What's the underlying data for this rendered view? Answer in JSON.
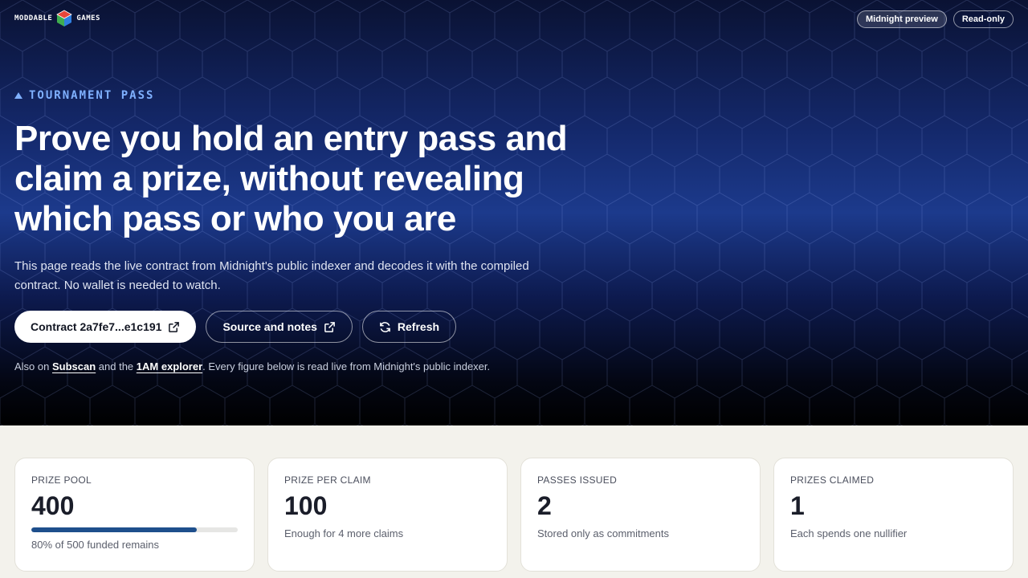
{
  "brand": {
    "left": "MODDABLE",
    "right": "GAMES"
  },
  "header_pills": [
    {
      "label": "Midnight preview",
      "active": true
    },
    {
      "label": "Read-only",
      "active": false
    }
  ],
  "hero": {
    "eyebrow": "TOURNAMENT PASS",
    "headline_lines": [
      "Prove you hold an entry pass and",
      "claim a prize, without revealing",
      "which pass or who you are"
    ],
    "intro": "This page reads the live contract from Midnight's public indexer and decodes it with the compiled contract. No wallet is needed to watch."
  },
  "actions": {
    "contract_label": "Contract 2a7fe7...e1c191",
    "source_label": "Source and notes",
    "refresh_label": "Refresh"
  },
  "footnote": {
    "prefix": "Also on ",
    "link1": "Subscan",
    "middle": " and the ",
    "link2": "1AM explorer",
    "suffix": ". Every figure below is read live from Midnight's public indexer."
  },
  "stats": [
    {
      "label": "PRIZE POOL",
      "value": "400",
      "sub": "80% of 500 funded remains",
      "progress": 0.8
    },
    {
      "label": "PRIZE PER CLAIM",
      "value": "100",
      "sub": "Enough for 4 more claims"
    },
    {
      "label": "PASSES ISSUED",
      "value": "2",
      "sub": "Stored only as commitments"
    },
    {
      "label": "PRIZES CLAIMED",
      "value": "1",
      "sub": "Each spends one nullifier"
    }
  ],
  "colors": {
    "accent": "#7fb0ff",
    "progress": "#1e4f8c",
    "page_bg": "#f3f2ec"
  },
  "icons": {
    "external": "external-link-icon",
    "refresh": "refresh-icon",
    "eyebrow": "triangle-icon",
    "logo": "cube-icon"
  }
}
